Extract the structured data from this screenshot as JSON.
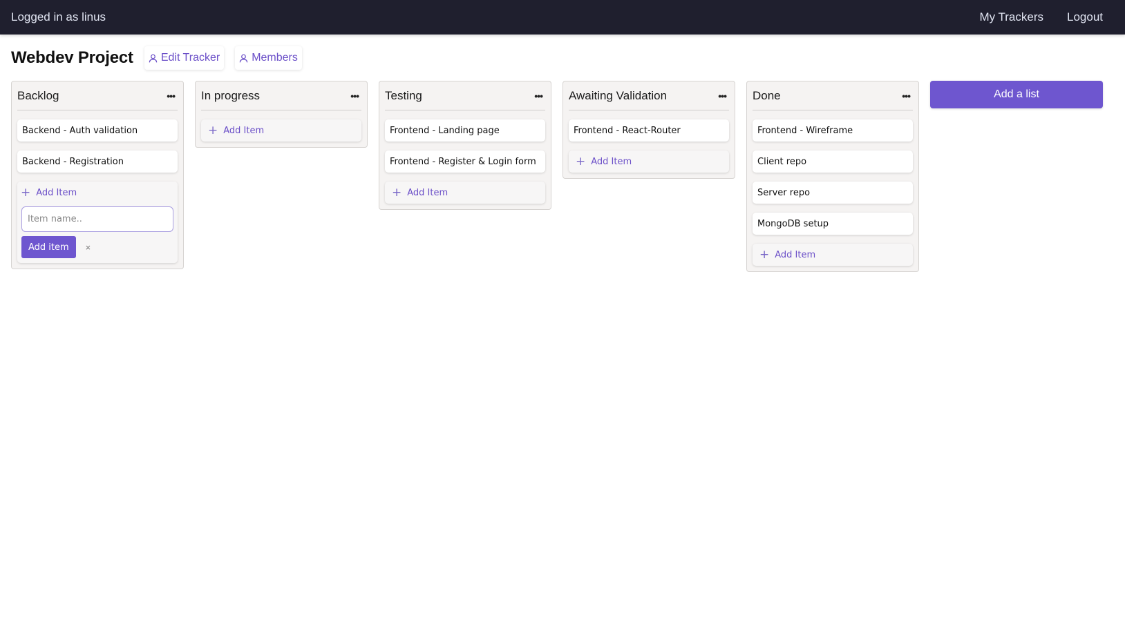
{
  "navbar": {
    "logged_in_text": "Logged in as linus",
    "links": [
      "My Trackers",
      "Logout"
    ]
  },
  "header": {
    "title": "Webdev Project",
    "edit_tracker_label": "Edit Tracker",
    "members_label": "Members",
    "icons": {
      "edit_tracker": "user-icon",
      "members": "user-icon"
    }
  },
  "board": {
    "add_item_label": "Add Item",
    "list_menu_glyph": "•••",
    "add_list_label": "Add a list",
    "lists": [
      {
        "title": "Backlog",
        "items": [
          "Backend - Auth validation",
          "Backend - Registration"
        ],
        "form_open": true
      },
      {
        "title": "In progress",
        "items": []
      },
      {
        "title": "Testing",
        "items": [
          "Frontend - Landing page",
          "Frontend - Register & Login form"
        ]
      },
      {
        "title": "Awaiting Validation",
        "items": [
          "Frontend - React-Router"
        ]
      },
      {
        "title": "Done",
        "items": [
          "Frontend - Wireframe",
          "Client repo",
          "Server repo",
          "MongoDB setup"
        ]
      }
    ],
    "add_form": {
      "input_value": "",
      "input_placeholder": "Item name..",
      "submit_label": "Add item",
      "cancel_glyph": "×"
    }
  },
  "colors": {
    "navbar_bg": "#1f1f2e",
    "accent": "#6e56cf",
    "list_bg": "#f5f3f2"
  }
}
